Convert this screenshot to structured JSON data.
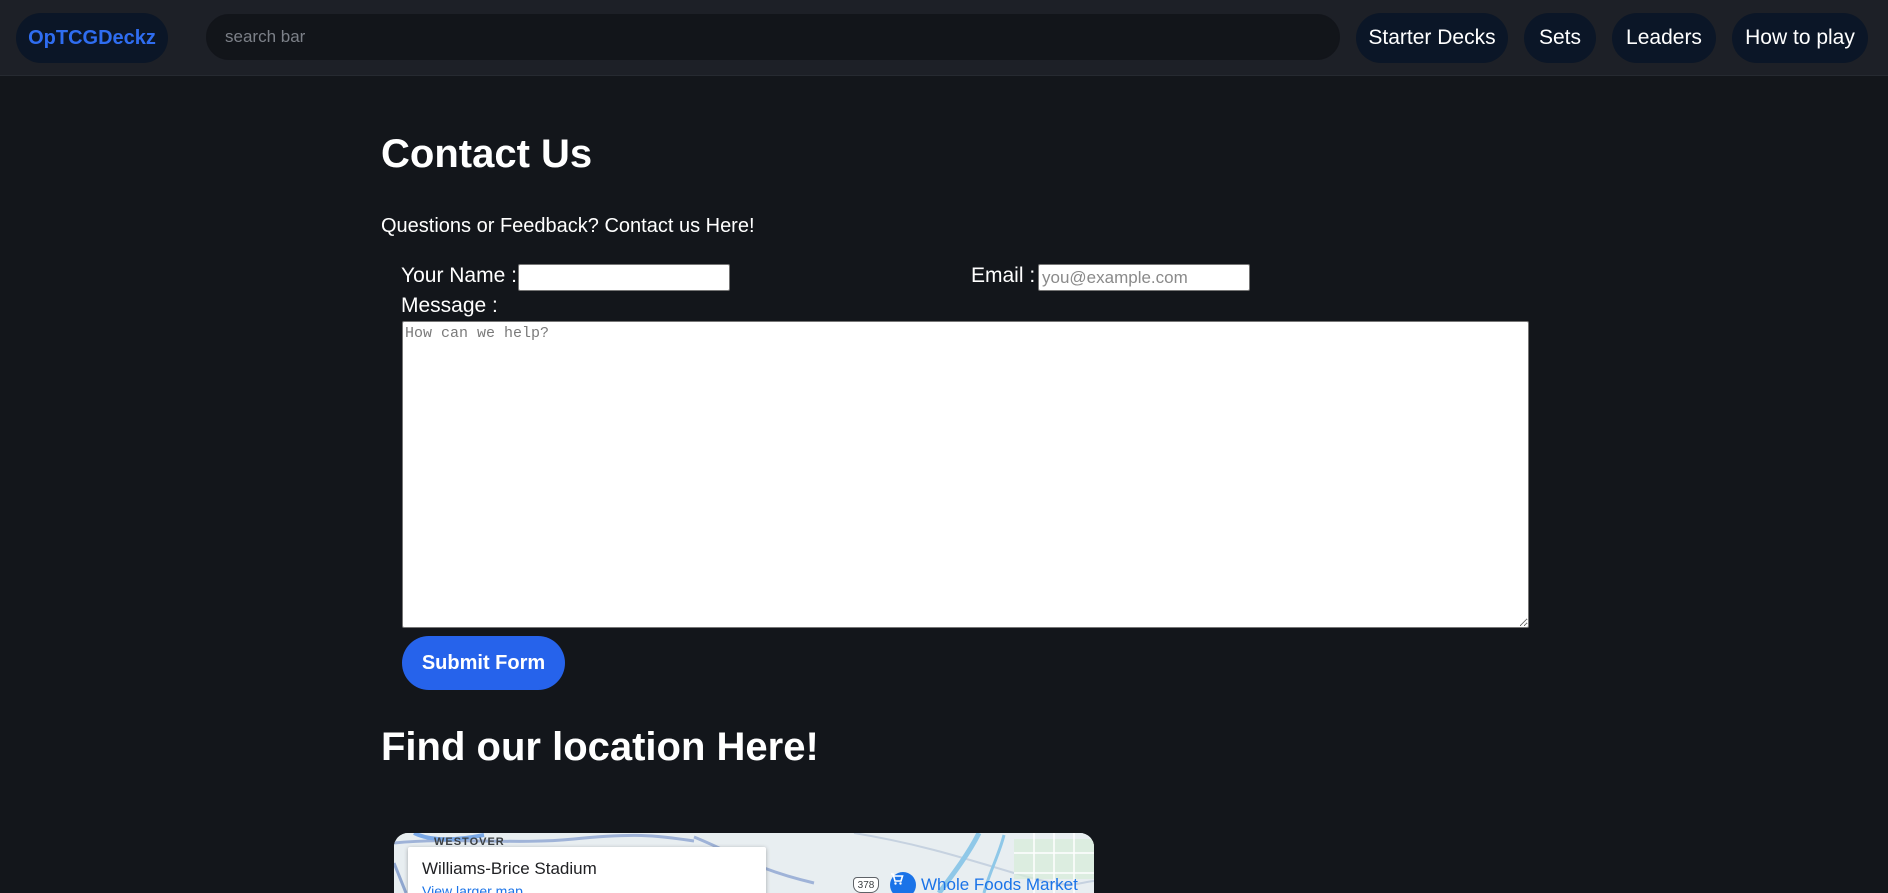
{
  "navbar": {
    "brand": "OpTCGDeckz",
    "search_placeholder": "search bar",
    "links": [
      "Starter Decks",
      "Sets",
      "Leaders",
      "How to play"
    ]
  },
  "contact": {
    "title": "Contact Us",
    "intro": "Questions or Feedback? Contact us Here!",
    "name_label": "Your Name :",
    "name_value": "",
    "email_label": "Email :",
    "email_placeholder": "you@example.com",
    "message_label": "Message :",
    "message_placeholder": "How can we help?",
    "submit_label": "Submit Form"
  },
  "location": {
    "title": "Find our location Here!",
    "map": {
      "place_name": "Williams-Brice Stadium",
      "view_larger_link": "View larger map",
      "area_label": "WESTOVER",
      "highway_shield": "378",
      "poi_label": "Whole Foods Market",
      "poi_icon": "shopping-cart-icon"
    }
  },
  "colors": {
    "background": "#13161b",
    "navbar": "#1d2027",
    "pill": "#0b1627",
    "brand_text": "#2f6df0",
    "accent": "#2663eb"
  }
}
